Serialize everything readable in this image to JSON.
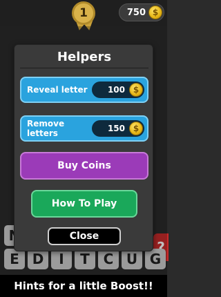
{
  "topbar": {
    "level": "1",
    "coins": "750",
    "coin_symbol": "$"
  },
  "background_tiles": {
    "row1": [
      "N",
      "?"
    ],
    "row2": [
      "E",
      "D",
      "I",
      "T",
      "C",
      "U",
      "G"
    ]
  },
  "dialog": {
    "title": "Helpers",
    "reveal_letter": {
      "label": "Reveal letter",
      "price": "100"
    },
    "remove_letters": {
      "label": "Remove letters",
      "price": "150"
    },
    "buy_coins_label": "Buy Coins",
    "how_to_play_label": "How To Play",
    "close_label": "Close"
  },
  "banner": "Hints for a little Boost!!",
  "colors": {
    "blue": "#2aa3de",
    "purple": "#9b3bb8",
    "green": "#1aa85a",
    "gold": "#e6b515"
  }
}
